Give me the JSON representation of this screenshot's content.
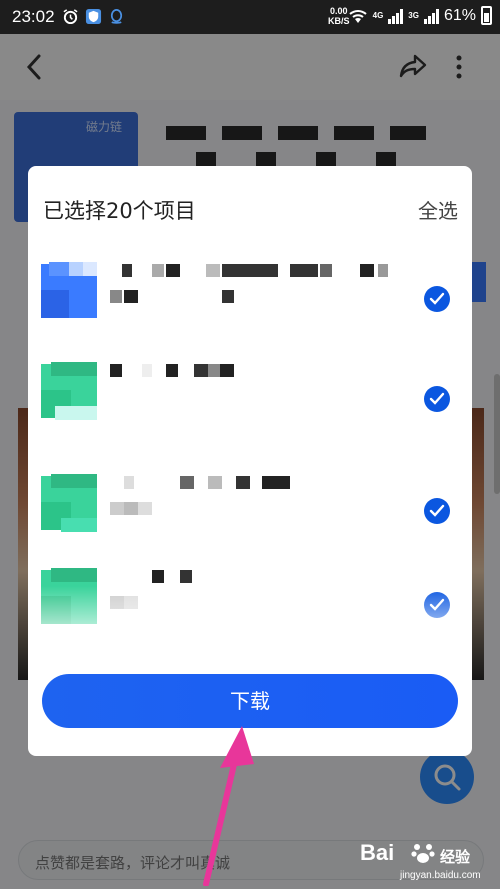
{
  "status_bar": {
    "time": "23:02",
    "speed_value": "0.00",
    "speed_unit": "KB/S",
    "net1": "4G",
    "net2": "3G",
    "battery": "61%"
  },
  "background": {
    "card_text": "磁力链",
    "comment_placeholder": "点赞都是套路，评论才叫真诚"
  },
  "dialog": {
    "title": "已选择20个项目",
    "select_all": "全选",
    "download_label": "下载",
    "files": [
      {
        "icon": "folder-blue-icon",
        "checked": true
      },
      {
        "icon": "folder-green-icon",
        "checked": true
      },
      {
        "icon": "folder-green-icon",
        "checked": true
      },
      {
        "icon": "folder-green-icon",
        "checked": true
      }
    ]
  },
  "watermark": {
    "brand": "Bai",
    "brand2": "经验",
    "url": "jingyan.baidu.com"
  },
  "colors": {
    "accent": "#1a5cf5",
    "check": "#0b57e0",
    "arrow": "#e8369a"
  }
}
